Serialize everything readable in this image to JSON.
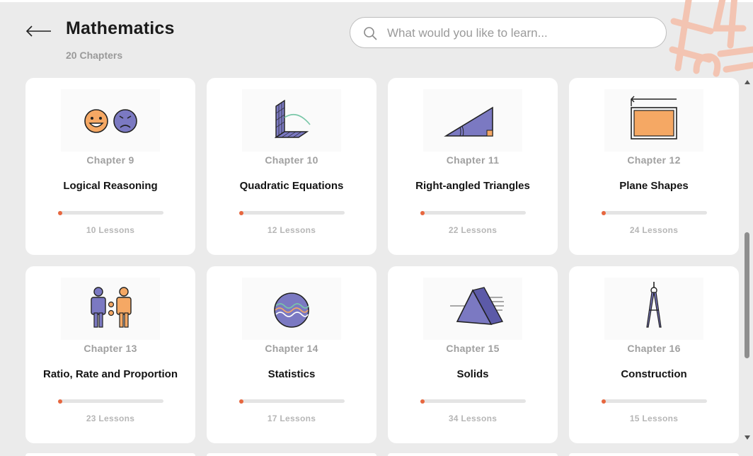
{
  "header": {
    "title": "Mathematics",
    "subtitle": "20 Chapters",
    "back_icon": "arrow-left-icon"
  },
  "search": {
    "placeholder": "What would you like to learn...",
    "value": "",
    "icon": "search-icon"
  },
  "chapters": [
    {
      "chapter": "Chapter 9",
      "name": "Logical Reasoning",
      "lessons": "10 Lessons",
      "icon": "faces-icon",
      "progress": 0
    },
    {
      "chapter": "Chapter 10",
      "name": "Quadratic Equations",
      "lessons": "12 Lessons",
      "icon": "graph-grid-icon",
      "progress": 0
    },
    {
      "chapter": "Chapter 11",
      "name": "Right-angled Triangles",
      "lessons": "22 Lessons",
      "icon": "right-triangle-icon",
      "progress": 0
    },
    {
      "chapter": "Chapter 12",
      "name": "Plane Shapes",
      "lessons": "24 Lessons",
      "icon": "rectangle-icon",
      "progress": 0
    },
    {
      "chapter": "Chapter 13",
      "name": "Ratio, Rate and Proportion",
      "lessons": "23 Lessons",
      "icon": "people-ratio-icon",
      "progress": 0
    },
    {
      "chapter": "Chapter 14",
      "name": "Statistics",
      "lessons": "17 Lessons",
      "icon": "wave-circle-icon",
      "progress": 0
    },
    {
      "chapter": "Chapter 15",
      "name": "Solids",
      "lessons": "34 Lessons",
      "icon": "prism-icon",
      "progress": 0
    },
    {
      "chapter": "Chapter 16",
      "name": "Construction",
      "lessons": "15 Lessons",
      "icon": "compass-icon",
      "progress": 0
    }
  ],
  "colors": {
    "accent": "#e7673f",
    "orange": "#f5a864",
    "purple": "#7b79c2",
    "background": "#ebebeb"
  }
}
